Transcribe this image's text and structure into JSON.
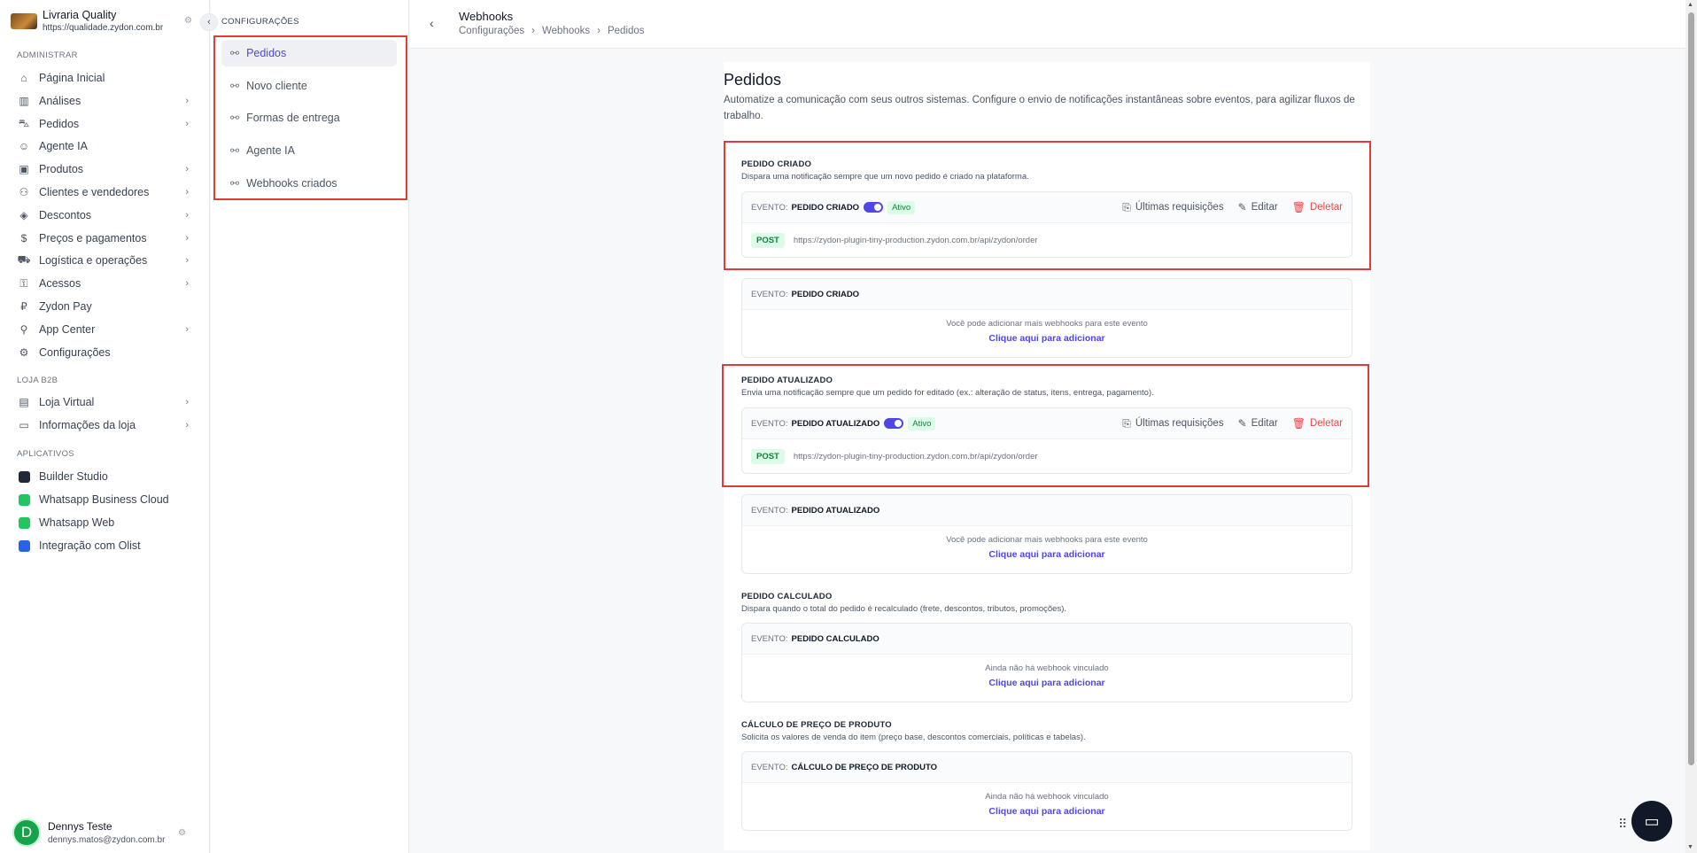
{
  "store": {
    "name": "Livraria Quality",
    "url": "https://qualidade.zydon.com.br"
  },
  "sections": {
    "admin": "ADMINISTRAR",
    "b2b": "LOJA B2B",
    "apps": "APLICATIVOS"
  },
  "nav_admin": [
    {
      "label": "Página Inicial",
      "icon": "home-icon",
      "chevron": false
    },
    {
      "label": "Análises",
      "icon": "chart-icon",
      "chevron": true
    },
    {
      "label": "Pedidos",
      "icon": "cart-icon",
      "chevron": true
    },
    {
      "label": "Agente IA",
      "icon": "bot-icon",
      "chevron": false
    },
    {
      "label": "Produtos",
      "icon": "box-icon",
      "chevron": true
    },
    {
      "label": "Clientes e vendedores",
      "icon": "users-icon",
      "chevron": true
    },
    {
      "label": "Descontos",
      "icon": "discount-icon",
      "chevron": true
    },
    {
      "label": "Preços e pagamentos",
      "icon": "dollar-icon",
      "chevron": true
    },
    {
      "label": "Logística e operações",
      "icon": "truck-icon",
      "chevron": true
    },
    {
      "label": "Acessos",
      "icon": "access-icon",
      "chevron": true
    },
    {
      "label": "Zydon Pay",
      "icon": "pay-icon",
      "chevron": false
    },
    {
      "label": "App Center",
      "icon": "plug-icon",
      "chevron": true
    },
    {
      "label": "Configurações",
      "icon": "gear-icon",
      "chevron": false
    }
  ],
  "nav_b2b": [
    {
      "label": "Loja Virtual",
      "icon": "store-icon",
      "chevron": true
    },
    {
      "label": "Informações da loja",
      "icon": "card-icon",
      "chevron": true
    }
  ],
  "nav_apps": [
    {
      "label": "Builder Studio",
      "color": "#1f2937"
    },
    {
      "label": "Whatsapp Business Cloud",
      "color": "#22c55e"
    },
    {
      "label": "Whatsapp Web",
      "color": "#22c55e"
    },
    {
      "label": "Integração com Olist",
      "color": "#2563eb"
    }
  ],
  "user": {
    "initial": "D",
    "name": "Dennys Teste",
    "email": "dennys.matos@zydon.com.br"
  },
  "config": {
    "title": "CONFIGURAÇÕES",
    "items": [
      "Pedidos",
      "Novo cliente",
      "Formas de entrega",
      "Agente IA",
      "Webhooks criados"
    ]
  },
  "header": {
    "title": "Webhooks",
    "crumbs": [
      "Configurações",
      "Webhooks",
      "Pedidos"
    ]
  },
  "page": {
    "title": "Pedidos",
    "description": "Automatize a comunicação com seus outros sistemas. Configure o envio de notificações instantâneas sobre eventos, para agilizar fluxos de trabalho."
  },
  "labels": {
    "event": "EVENTO:",
    "active": "Ativo",
    "last_requests": "Últimas requisições",
    "edit": "Editar",
    "delete": "Deletar",
    "post": "POST",
    "more": "Você pode adicionar mais webhooks para este evento",
    "none": "Ainda não há webhook vinculado",
    "add": "Clique aqui para adicionar"
  },
  "events": {
    "criado": {
      "title": "PEDIDO CRIADO",
      "desc": "Dispara uma notificação sempre que um novo pedido é criado na plataforma.",
      "url": "https://zydon-plugin-tiny-production.zydon.com.br/api/zydon/order"
    },
    "atualizado": {
      "title": "PEDIDO ATUALIZADO",
      "desc": "Envia uma notificação sempre que um pedido for editado (ex.: alteração de status, itens, entrega, pagamento).",
      "url": "https://zydon-plugin-tiny-production.zydon.com.br/api/zydon/order"
    },
    "calculado": {
      "title": "PEDIDO CALCULADO",
      "desc": "Dispara quando o total do pedido é recalculado (frete, descontos, tributos, promoções)."
    },
    "preco": {
      "title": "CÁLCULO DE PREÇO DE PRODUTO",
      "desc": "Solicita os valores de venda do item (preço base, descontos comerciais, políticas e tabelas)."
    }
  }
}
